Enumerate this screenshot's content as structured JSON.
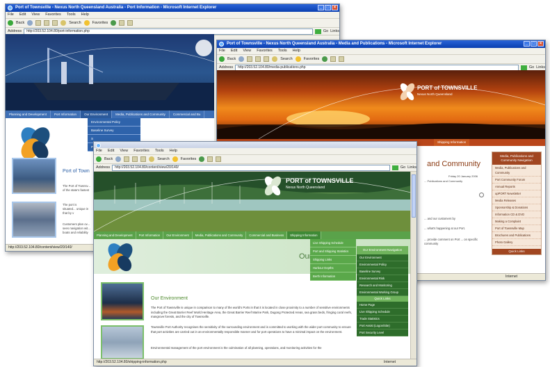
{
  "win1": {
    "title": "Port of Townsville - Nexus North Queensland Australia - Port Information - Microsoft Internet Explorer",
    "menu": [
      "File",
      "Edit",
      "View",
      "Favorites",
      "Tools",
      "Help"
    ],
    "toolbar": {
      "back": "Back",
      "search": "Search",
      "favorites": "Favorites"
    },
    "address_label": "Address",
    "address": "http://203.52.104.80/port-information.php",
    "go": "Go",
    "links": "Links",
    "nav": [
      "Planning and Development",
      "Port Information",
      "Our Environment",
      "Media, Publications and Community",
      "Commercial and Bu"
    ],
    "dropdown": [
      "Environmental Policy",
      "Baseline Survey",
      "S",
      "P"
    ],
    "heading": "Port of Town",
    "para1": "The Port of Townsv... of the state's fastest",
    "para2": "The port is situated... unique in that by v",
    "para3": "Customers plan ov... sees navigation wit... boats and reliability",
    "status": "http://203.52.104.80/content/view/20/140/"
  },
  "win2": {
    "title": "Port of Townsville - Nexus North Queensland Australia - Media and Publications - Microsoft Internet Explorer",
    "menu": [
      "File",
      "Edit",
      "View",
      "Favorites",
      "Tools",
      "Help"
    ],
    "toolbar": {
      "back": "Back",
      "search": "Search",
      "favorites": "Favorites"
    },
    "address_label": "Address",
    "address": "http://203.52.104.80/media-publications.php",
    "go": "Go",
    "links": "Links",
    "logo_title": "PORT of TOWNSVILLE",
    "logo_sub": "Nexus North Queensland",
    "nav_tab": "Shipping Information",
    "heading": "and Community",
    "date": "Friday 20 January 2006",
    "crumb": "... Publications and Community",
    "para1": "... and our customers by",
    "para2": "... what's happening at our Port.",
    "para3": "... provide comment on Port ... on specific community",
    "panel_head": "Media, Publications and Community Navigation",
    "panel_items": [
      "Media, Publications and Community",
      "Port Community Forum",
      "Annual Reports",
      "upPORT Newsletter",
      "Media Releases",
      "Sponsorship & Donations",
      "Information CD & DVD",
      "Making a Complaint",
      "Port of Townsville Map",
      "Brochures and Publications",
      "Photo Gallery"
    ],
    "panel_head2": "Quick Links",
    "status": "Internet"
  },
  "win3": {
    "title": "Port of Townsville - Nexus North Queensland Australia - Shipping Information",
    "menu": [
      "File",
      "Edit",
      "View",
      "Favorites",
      "Tools",
      "Help"
    ],
    "toolbar": {
      "back": "Back",
      "search": "Search",
      "favorites": "Favorites"
    },
    "address_label": "Address",
    "address": "http://203.52.104.80/content/view/20/140/",
    "go": "Go",
    "links": "Links",
    "logo_title": "PORT of TOWNSVILLE",
    "logo_sub": "Nexus North Queensland",
    "nav": [
      "Planning and Development",
      "Port Information",
      "Our Environment",
      "Media, Publications and Community",
      "Commercial and Business",
      "Shipping Information"
    ],
    "dropdown": [
      "Live Shipping Schedule",
      "Port and Shipping Statistics",
      "Shipping Links",
      "Harbour Depths",
      "Berth Information"
    ],
    "heading": "Our E",
    "rightnav_head": "Our Environment Navigation",
    "rightnav_items": [
      "Our Environment",
      "Environmental Policy",
      "Baseline Survey",
      "Environmental Risk",
      "Research and Monitoring",
      "Environmental Working Group"
    ],
    "rightnav_head2": "Quick Links",
    "quick_links": [
      "Home Page",
      "Live Shipping Schedule",
      "Trade Statistics",
      "Port Assist (Logon/Site)",
      "Port Security Level"
    ],
    "subhead": "Our Environment",
    "p1": "The Port of Townsville is unique in comparison to many of the world's Ports in that it is located in close proximity to a number of sensitive environments including the Great Barrier Reef World Heritage Area, the Great Barrier Reef Marine Park, Dugong Protected Areas, sea grass beds, fringing coral reefs, mangrove forests, and the city of Townsville.",
    "p2": "Townsville Port Authority recognises the sensitivity of the surrounding environment and is committed to working with the wider port community to ensure that port activities are carried out in an environmentally responsible manner and for port operations to have a minimal impact on the environment.",
    "p3": "Environmental management of the port environment is the culmination of all planning, operations, and monitoring activities for the",
    "status": "http://203.52.104.80/shipping-information.php",
    "zone": "Internet"
  },
  "colors": {
    "ie_blue": "#0a3fb0",
    "w1_nav": "#3e6fb5",
    "w2_nav": "#b9461a",
    "w3_nav": "#5aa24a"
  }
}
